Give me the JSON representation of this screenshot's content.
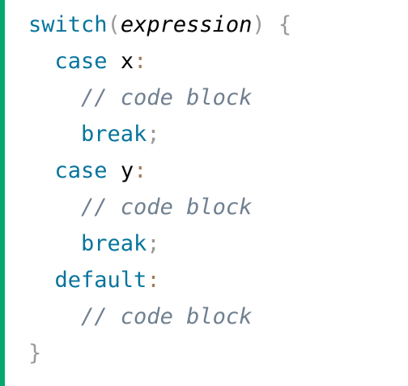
{
  "code": {
    "line1": {
      "keyword": "switch",
      "open_paren": "(",
      "expr": "expression",
      "close_paren": ")",
      "brace": "{"
    },
    "line2": {
      "keyword": "case",
      "ident": "x",
      "colon": ":"
    },
    "line3": {
      "comment": "// code block"
    },
    "line4": {
      "keyword": "break",
      "semi": ";"
    },
    "line5": {
      "keyword": "case",
      "ident": "y",
      "colon": ":"
    },
    "line6": {
      "comment": "// code block"
    },
    "line7": {
      "keyword": "break",
      "semi": ";"
    },
    "line8": {
      "keyword": "default",
      "colon": ":"
    },
    "line9": {
      "comment": "// code block"
    },
    "line10": {
      "brace": "}"
    }
  },
  "colors": {
    "accent_bar": "#04aa6d",
    "keyword": "#07749c",
    "punctuation": "#999999",
    "colon": "#a67f59",
    "comment": "#708090"
  }
}
